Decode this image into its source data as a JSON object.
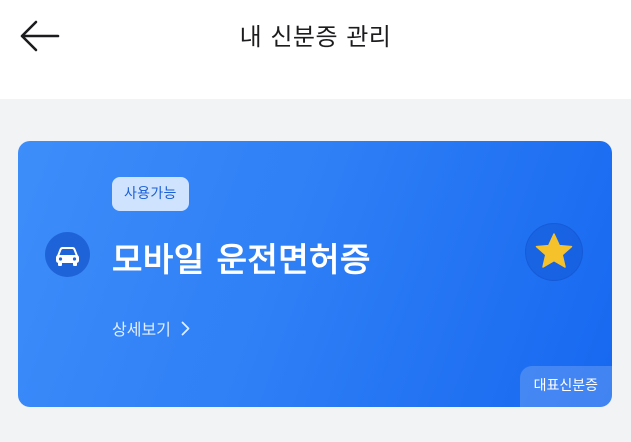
{
  "header": {
    "title": "내 신분증 관리",
    "back_icon": "arrow-left-icon"
  },
  "card": {
    "status_badge": "사용가능",
    "title": "모바일 운전면허증",
    "detail_link": "상세보기",
    "representative_badge": "대표신분증",
    "icons": {
      "type_icon": "car-icon",
      "favorite_icon": "star-icon",
      "detail_chevron": "chevron-right-icon"
    },
    "colors": {
      "card_gradient_start": "#3d8dfa",
      "card_gradient_end": "#1768f0",
      "star": "#f6c22b",
      "badge_bg": "#cfe3ff",
      "badge_text": "#1a5fd6"
    }
  }
}
